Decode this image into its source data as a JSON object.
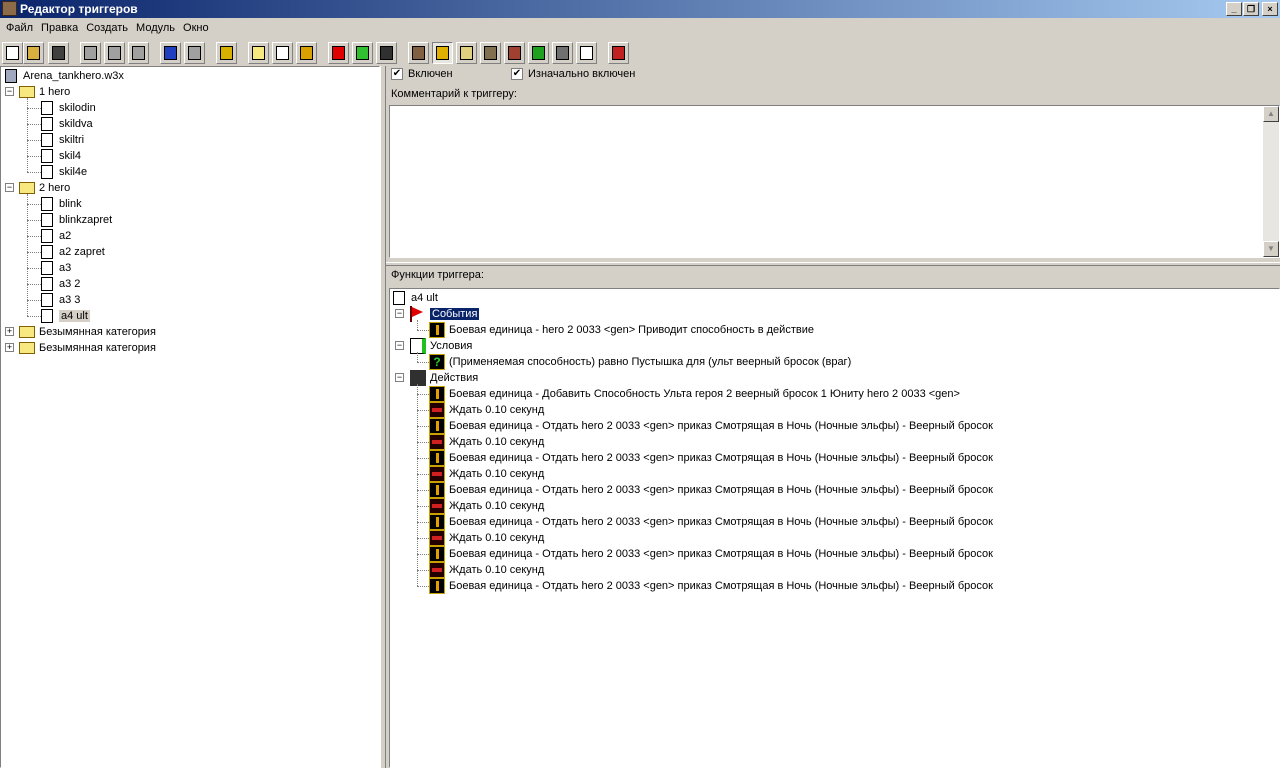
{
  "window": {
    "title": "Редактор триггеров",
    "minimize": "_",
    "restore": "❐",
    "close": "×"
  },
  "menu": [
    "Файл",
    "Правка",
    "Создать",
    "Модуль",
    "Окно"
  ],
  "toolbar": [
    {
      "icon": "new-icon",
      "color": "#ffffff"
    },
    {
      "icon": "open-icon",
      "color": "#d8b040"
    },
    {
      "icon": "save-icon",
      "color": "#404040"
    },
    {
      "icon": "cut-icon",
      "color": "#a0a0a0"
    },
    {
      "icon": "copy-icon",
      "color": "#a0a0a0"
    },
    {
      "icon": "paste-icon",
      "color": "#a0a0a0"
    },
    {
      "icon": "undo-icon",
      "color": "#2040c0"
    },
    {
      "icon": "redo-icon",
      "color": "#a0a0a0"
    },
    {
      "icon": "delete-icon",
      "color": "#d8b000"
    },
    {
      "icon": "new-category-icon",
      "color": "#f8e880"
    },
    {
      "icon": "new-trigger-icon",
      "color": "#ffffff"
    },
    {
      "icon": "new-comment-icon",
      "color": "#d8a000"
    },
    {
      "icon": "new-event-icon",
      "color": "#e00000"
    },
    {
      "icon": "new-condition-icon",
      "color": "#30c030"
    },
    {
      "icon": "new-action-icon",
      "color": "#303030"
    },
    {
      "icon": "terrain-editor-icon",
      "color": "#806040"
    },
    {
      "icon": "trigger-editor-icon",
      "color": "#e0b000"
    },
    {
      "icon": "sound-editor-icon",
      "color": "#e0d080"
    },
    {
      "icon": "object-editor-icon",
      "color": "#807050"
    },
    {
      "icon": "campaign-editor-icon",
      "color": "#a04030"
    },
    {
      "icon": "ai-editor-icon",
      "color": "#20a020"
    },
    {
      "icon": "import-manager-icon",
      "color": "#707070"
    },
    {
      "icon": "object-manager-icon",
      "color": "#ffffff"
    },
    {
      "icon": "test-map-icon",
      "color": "#c02020"
    }
  ],
  "left_tree": {
    "root": "Arena_tankhero.w3x",
    "categories": [
      {
        "name": "1 hero",
        "expanded": true,
        "items": [
          "skilodin",
          "skildva",
          "skiltri",
          "skil4",
          "skil4e"
        ]
      },
      {
        "name": "2 hero",
        "expanded": true,
        "items": [
          "blink",
          "blinkzapret",
          "a2",
          "a2 zapret",
          "a3",
          "a3 2",
          "a3 3",
          "a4 ult"
        ]
      },
      {
        "name": "Безымянная категория",
        "expanded": false,
        "items": []
      },
      {
        "name": "Безымянная категория",
        "expanded": false,
        "items": []
      }
    ],
    "selected": "a4 ult"
  },
  "trigger": {
    "enabled_label": "Включен",
    "enabled": true,
    "initially_on_label": "Изначально включен",
    "initially_on": true,
    "comment_label": "Комментарий к триггеру:",
    "comment": "",
    "functions_label": "Функции триггера:",
    "name": "a4 ult",
    "events_label": "События",
    "events": [
      {
        "icon": "unit",
        "text": "Боевая единица - hero 2 0033 <gen> Приводит способность в действие"
      }
    ],
    "conditions_label": "Условия",
    "conditions": [
      {
        "icon": "q",
        "text": "(Применяемая способность) равно Пустышка для (ульт веерный бросок (враг)"
      }
    ],
    "actions_label": "Действия",
    "actions": [
      {
        "icon": "unit",
        "text": "Боевая единица - Добавить Способность Ульта героя 2 веерный бросок 1  Юниту hero 2 0033 <gen>"
      },
      {
        "icon": "wait",
        "text": "Ждать 0.10 секунд"
      },
      {
        "icon": "unit",
        "text": "Боевая единица - Отдать hero 2 0033 <gen> приказ Смотрящая в Ночь (Ночные эльфы) - Веерный бросок"
      },
      {
        "icon": "wait",
        "text": "Ждать 0.10 секунд"
      },
      {
        "icon": "unit",
        "text": "Боевая единица - Отдать hero 2 0033 <gen> приказ Смотрящая в Ночь (Ночные эльфы) - Веерный бросок"
      },
      {
        "icon": "wait",
        "text": "Ждать 0.10 секунд"
      },
      {
        "icon": "unit",
        "text": "Боевая единица - Отдать hero 2 0033 <gen> приказ Смотрящая в Ночь (Ночные эльфы) - Веерный бросок"
      },
      {
        "icon": "wait",
        "text": "Ждать 0.10 секунд"
      },
      {
        "icon": "unit",
        "text": "Боевая единица - Отдать hero 2 0033 <gen> приказ Смотрящая в Ночь (Ночные эльфы) - Веерный бросок"
      },
      {
        "icon": "wait",
        "text": "Ждать 0.10 секунд"
      },
      {
        "icon": "unit",
        "text": "Боевая единица - Отдать hero 2 0033 <gen> приказ Смотрящая в Ночь (Ночные эльфы) - Веерный бросок"
      },
      {
        "icon": "wait",
        "text": "Ждать 0.10 секунд"
      },
      {
        "icon": "unit",
        "text": "Боевая единица - Отдать hero 2 0033 <gen> приказ Смотрящая в Ночь (Ночные эльфы) - Веерный бросок"
      }
    ]
  }
}
